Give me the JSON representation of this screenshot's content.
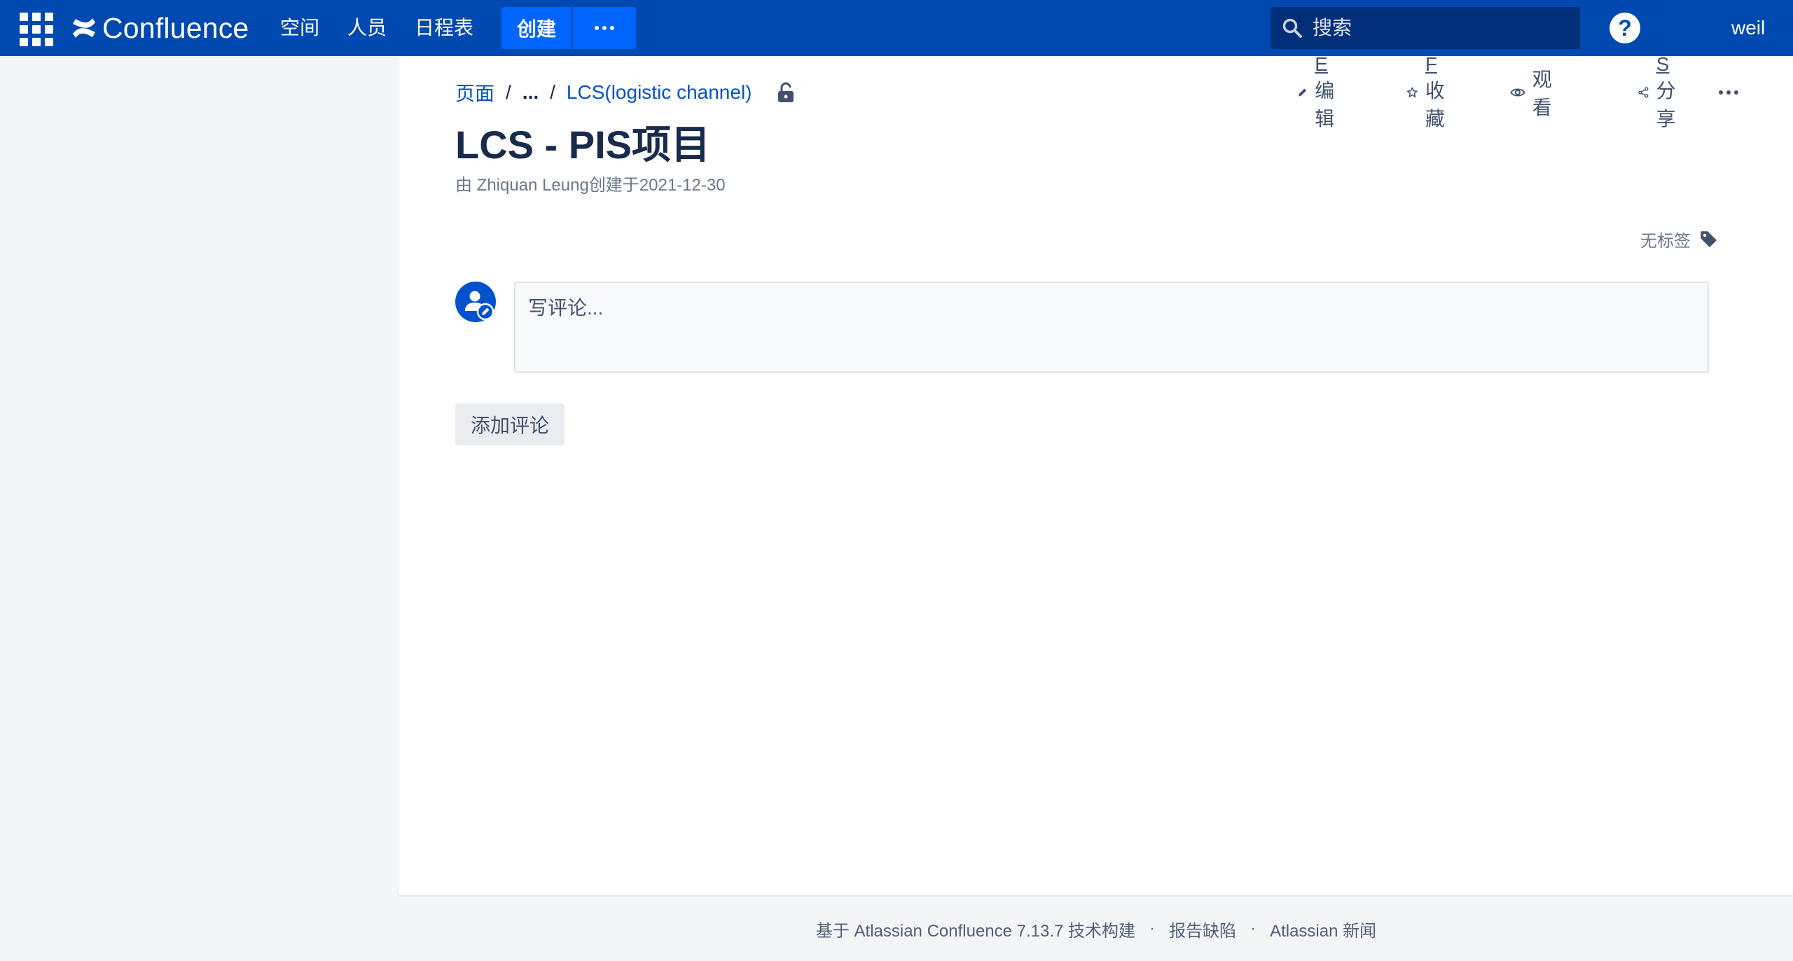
{
  "header": {
    "product_name": "Confluence",
    "nav": [
      "空间",
      "人员",
      "日程表"
    ],
    "create_label": "创建",
    "search_placeholder": "搜索",
    "help_label": "?",
    "user_name": "weil"
  },
  "breadcrumb": {
    "items": [
      "页面",
      "...",
      "LCS(logistic channel)"
    ]
  },
  "page_actions": {
    "edit": {
      "key": "E",
      "label": "编辑"
    },
    "favorite": {
      "key": "F",
      "label": "收藏"
    },
    "watch": {
      "label": "观看"
    },
    "share": {
      "key": "S",
      "label": "分享"
    }
  },
  "page": {
    "title": "LCS - PIS项目",
    "byline_prefix": "由 ",
    "author": "Zhiquan Leung",
    "byline_suffix": "创建于2021-12-30",
    "labels_text": "无标签"
  },
  "comment": {
    "placeholder": "写评论...",
    "add_button": "添加评论"
  },
  "footer": {
    "powered_by": "基于 Atlassian Confluence 7.13.7 技术构建",
    "report_bug": "报告缺陷",
    "news": "Atlassian 新闻"
  },
  "colors": {
    "header_bg": "#0049b0",
    "primary": "#0065ff",
    "link": "#0052cc",
    "search_bg": "#002e79"
  }
}
